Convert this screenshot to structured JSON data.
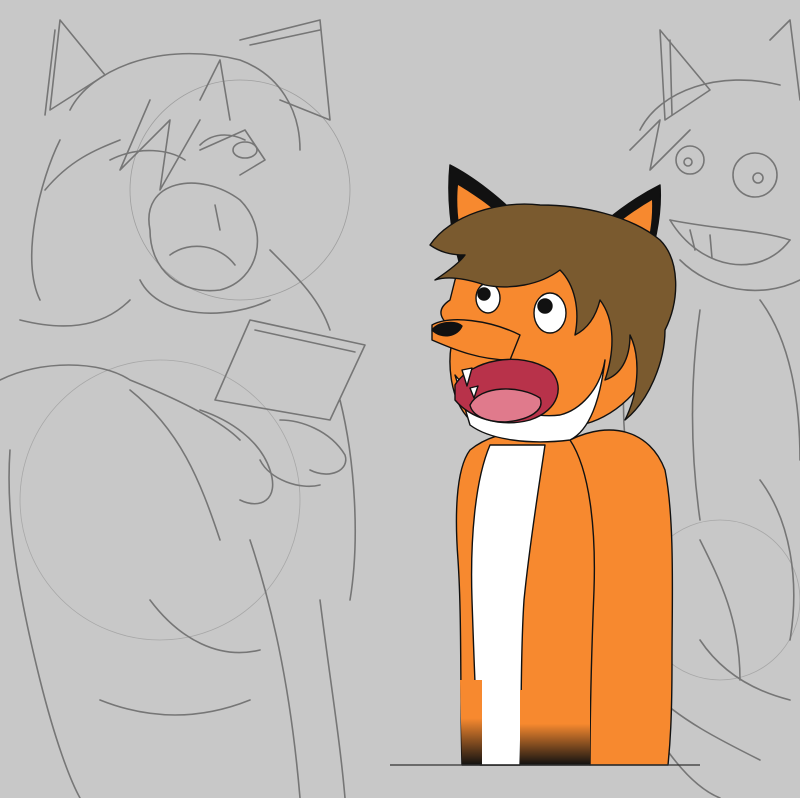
{
  "artwork": {
    "background_color": "#c8c8c8",
    "sketch_color": "#6e6e6e",
    "fox_orange": "#f7892f",
    "fox_white": "#ffffff",
    "hair_brown": "#7a5a2f",
    "outline_color": "#111111",
    "mouth_color": "#b8324a",
    "tongue_color": "#e07a8c"
  }
}
